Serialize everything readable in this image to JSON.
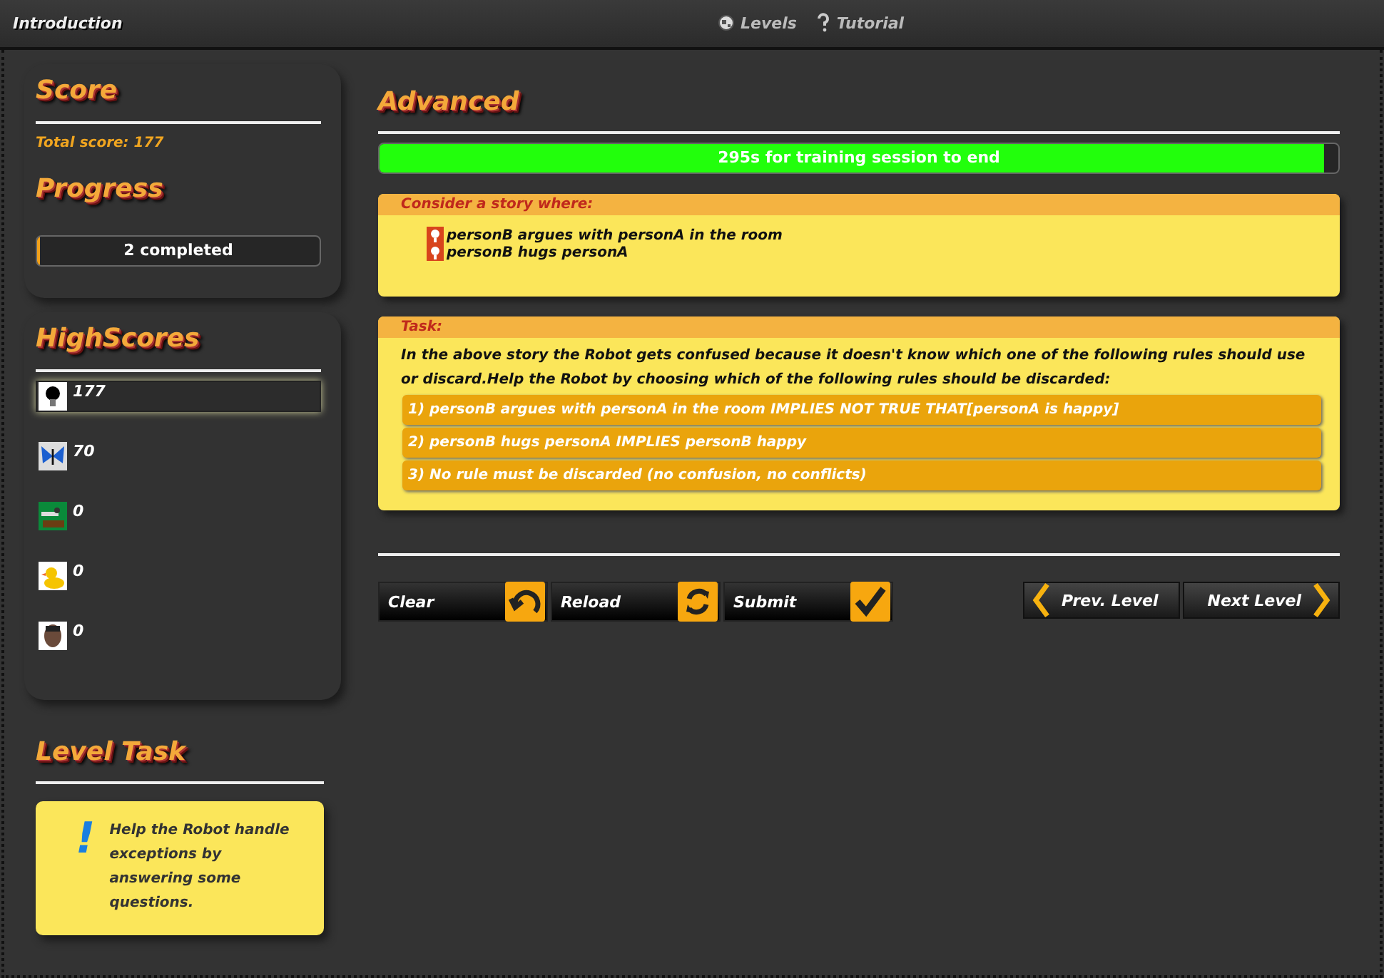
{
  "top_bar": {
    "title": "Introduction",
    "links": [
      {
        "label": "Levels",
        "kind": "globe"
      },
      {
        "label": "Tutorial",
        "kind": "help"
      }
    ]
  },
  "score": {
    "heading": "Score",
    "total": "Total score: 177"
  },
  "progress": {
    "heading": "Progress",
    "level": 0.01,
    "label": "2 completed"
  },
  "highscores": {
    "heading": "HighScores",
    "items": [
      {
        "score": "177",
        "selected": true
      },
      {
        "score": "70",
        "selected": false
      },
      {
        "score": "0",
        "selected": false
      },
      {
        "score": "0",
        "selected": false
      },
      {
        "score": "0",
        "selected": false
      }
    ]
  },
  "level_task": {
    "heading": "Level Task",
    "mark": "!",
    "text": "Help the Robot handle exceptions by answering some questions."
  },
  "main": {
    "heading": "Advanced",
    "timer": {
      "level": 0.985,
      "label": "295s for training session to end"
    },
    "story": {
      "heading": "Consider a story where:",
      "facts": [
        "personB argues with personA in the room",
        "personB hugs personA"
      ]
    },
    "task": {
      "heading": "Task:",
      "text": "In the above story the Robot gets confused because it doesn't know which one of the following rules should use or discard.Help the Robot by choosing which of the following rules should be discarded:",
      "options": [
        {
          "label": "1) personB argues with personA in the room IMPLIES NOT TRUE THAT[personA is happy]",
          "selected": false
        },
        {
          "label": "2) personB hugs personA IMPLIES personB happy",
          "selected": false
        },
        {
          "label": "3) No rule must be discarded (no confusion, no conflicts)",
          "selected": false
        }
      ]
    },
    "actions": [
      {
        "label": "Clear",
        "kind": "undo"
      },
      {
        "label": "Reload",
        "kind": "reload"
      },
      {
        "label": "Submit",
        "kind": "check"
      }
    ],
    "nav": [
      {
        "label": "Prev. Level",
        "kind": "prev"
      },
      {
        "label": "Next Level",
        "kind": "next"
      }
    ]
  }
}
